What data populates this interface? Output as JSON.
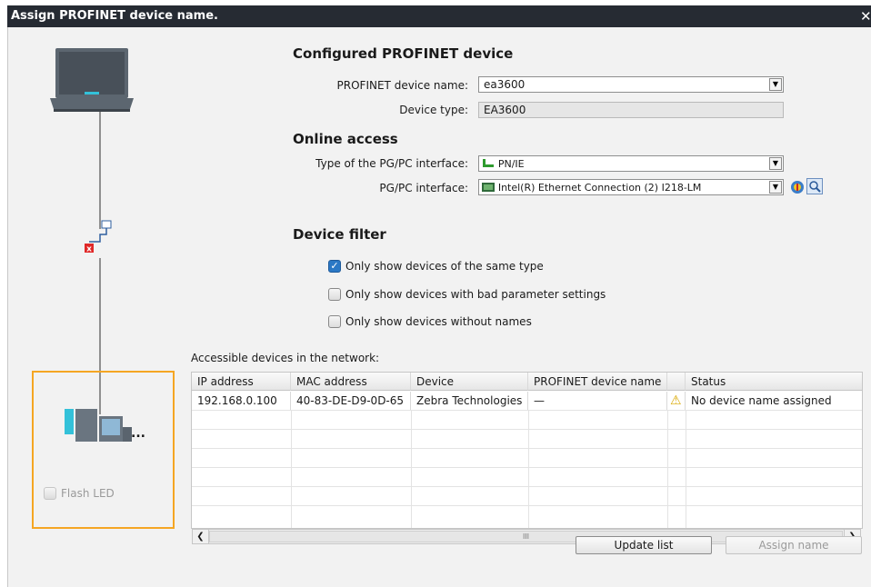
{
  "window": {
    "title": "Assign PROFINET device name."
  },
  "configured": {
    "header": "Configured PROFINET device",
    "name_label": "PROFINET device name:",
    "name_value": "ea3600",
    "type_label": "Device type:",
    "type_value": "EA3600"
  },
  "online": {
    "header": "Online access",
    "iface_type_label": "Type of the PG/PC interface:",
    "iface_type_value": "PN/IE",
    "iface_label": "PG/PC interface:",
    "iface_value": "Intel(R) Ethernet Connection (2) I218-LM"
  },
  "filter": {
    "header": "Device filter",
    "options": [
      {
        "label": "Only show devices of the same type",
        "checked": true
      },
      {
        "label": "Only show devices with bad parameter settings",
        "checked": false
      },
      {
        "label": "Only show devices without names",
        "checked": false
      }
    ]
  },
  "network": {
    "label": "Accessible devices in the network:",
    "columns": [
      "IP address",
      "MAC address",
      "Device",
      "PROFINET device name",
      "",
      "Status"
    ],
    "rows": [
      [
        "192.168.0.100",
        "40-83-DE-D9-0D-65",
        "Zebra Technologies",
        "—",
        "⚠",
        "No device name assigned"
      ]
    ],
    "scroll_grip": "III"
  },
  "buttons": {
    "update": "Update list",
    "assign": "Assign name"
  },
  "left_panel": {
    "flash_led": "Flash LED",
    "more": "..."
  },
  "colors": {
    "accent": "#f5a623",
    "titlebar": "#262b33",
    "check": "#2b78c5"
  }
}
